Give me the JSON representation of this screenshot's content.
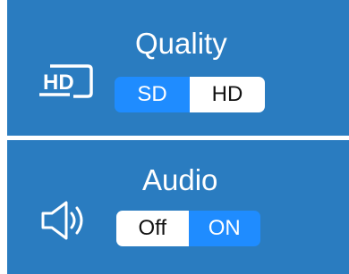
{
  "quality": {
    "title": "Quality",
    "icon": "hd-icon",
    "options": [
      {
        "label": "SD",
        "selected": false
      },
      {
        "label": "HD",
        "selected": true
      }
    ]
  },
  "audio": {
    "title": "Audio",
    "icon": "speaker-icon",
    "options": [
      {
        "label": "Off",
        "selected": true
      },
      {
        "label": "ON",
        "selected": false
      }
    ]
  },
  "colors": {
    "panel_background": "#2a7cc0",
    "segment_blue": "#1f8cff",
    "segment_white": "#ffffff",
    "divider": "#ffffff"
  }
}
